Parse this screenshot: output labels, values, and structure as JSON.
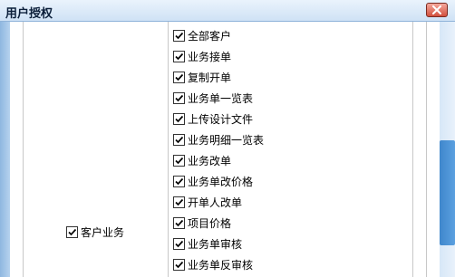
{
  "window": {
    "title": "用户授权",
    "close_icon": "close-icon"
  },
  "group": {
    "label": "客户业务",
    "checked": true
  },
  "permissions": [
    {
      "label": "全部客户",
      "checked": true
    },
    {
      "label": "业务接单",
      "checked": true
    },
    {
      "label": "复制开单",
      "checked": true
    },
    {
      "label": "业务单一览表",
      "checked": true
    },
    {
      "label": "上传设计文件",
      "checked": true
    },
    {
      "label": "业务明细一览表",
      "checked": true
    },
    {
      "label": "业务改单",
      "checked": true
    },
    {
      "label": "业务单改价格",
      "checked": true
    },
    {
      "label": "开单人改单",
      "checked": true
    },
    {
      "label": "项目价格",
      "checked": true
    },
    {
      "label": "业务单审核",
      "checked": true
    },
    {
      "label": "业务单反审核",
      "checked": true
    }
  ],
  "colors": {
    "titlebar": "#dbe9f7",
    "close_button": "#d2503e",
    "scroll_thumb": "#4a93d6"
  }
}
